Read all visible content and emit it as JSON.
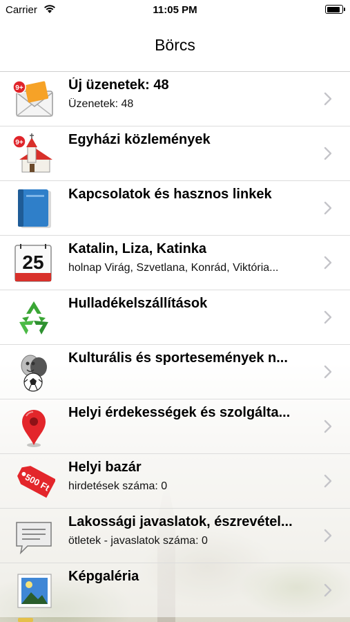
{
  "status_bar": {
    "carrier": "Carrier",
    "time": "11:05 PM"
  },
  "nav": {
    "title": "Börcs"
  },
  "rows": [
    {
      "title": "Új üzenetek: 48",
      "subtitle": "Üzenetek: 48",
      "icon": "mail-envelope-icon",
      "badge": "9+"
    },
    {
      "title": "Egyházi közlemények",
      "subtitle": "",
      "icon": "church-icon",
      "badge": "9+"
    },
    {
      "title": "Kapcsolatok és hasznos linkek",
      "subtitle": "",
      "icon": "address-book-icon"
    },
    {
      "title": "Katalin, Liza, Katinka",
      "subtitle": "holnap Virág, Szvetlana, Konrád, Viktória...",
      "icon": "calendar-icon",
      "calendar_day": "25"
    },
    {
      "title": "Hulladékelszállítások",
      "subtitle": "",
      "icon": "recycle-icon"
    },
    {
      "title": "Kulturális és sportesemények n...",
      "subtitle": "",
      "icon": "theater-masks-football-icon"
    },
    {
      "title": "Helyi érdekességek és szolgálta...",
      "subtitle": "",
      "icon": "map-pin-icon"
    },
    {
      "title": "Helyi bazár",
      "subtitle": "hirdetések száma: 0",
      "icon": "price-tag-icon",
      "tag_text": "500 Ft"
    },
    {
      "title": "Lakossági javaslatok, észrevétel...",
      "subtitle": "ötletek - javaslatok száma: 0",
      "icon": "speech-bubble-icon"
    },
    {
      "title": "Képgaléria",
      "subtitle": "",
      "icon": "photo-gallery-icon"
    }
  ],
  "colors": {
    "separator": "#dcdcdc",
    "chevron": "#c4c4c9",
    "badge_red": "#e0242a",
    "pin_red": "#e3262b",
    "recycle_green": "#3aa635"
  }
}
